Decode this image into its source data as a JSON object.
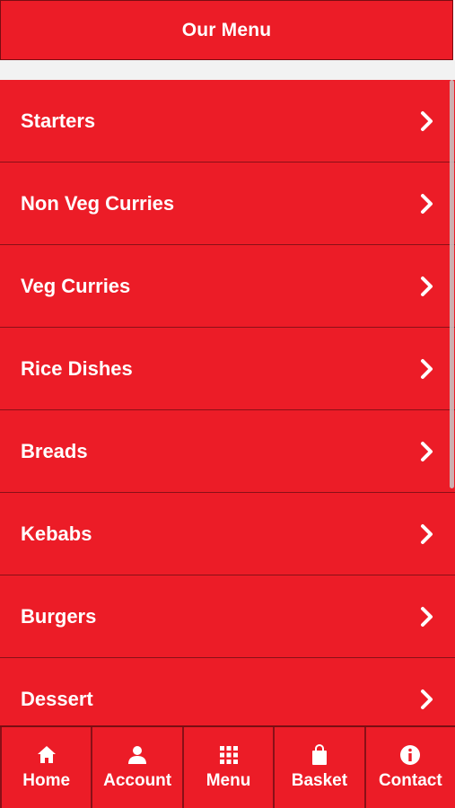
{
  "header": {
    "title": "Our Menu"
  },
  "menu": {
    "items": [
      {
        "label": "Starters"
      },
      {
        "label": "Non Veg Curries"
      },
      {
        "label": "Veg Curries"
      },
      {
        "label": "Rice Dishes"
      },
      {
        "label": "Breads"
      },
      {
        "label": "Kebabs"
      },
      {
        "label": "Burgers"
      },
      {
        "label": "Dessert"
      }
    ]
  },
  "nav": {
    "items": [
      {
        "label": "Home",
        "icon": "home-icon"
      },
      {
        "label": "Account",
        "icon": "user-icon"
      },
      {
        "label": "Menu",
        "icon": "grid-icon"
      },
      {
        "label": "Basket",
        "icon": "bag-icon"
      },
      {
        "label": "Contact",
        "icon": "info-icon"
      }
    ]
  },
  "colors": {
    "brand": "#ec1c27",
    "divider": "#8a1017",
    "text": "#ffffff",
    "spacer": "#f2f2f2"
  }
}
